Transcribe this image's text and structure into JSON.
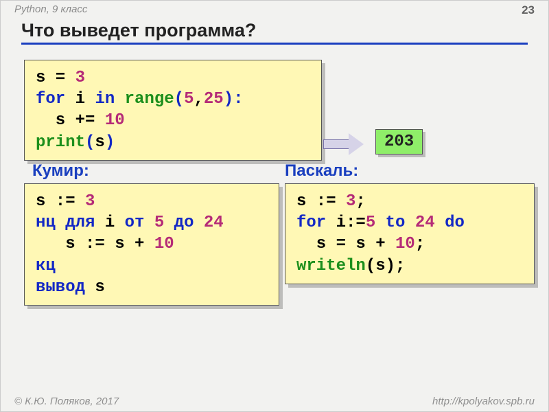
{
  "header": {
    "course": "Python, 9 класс",
    "page": "23"
  },
  "title": "Что выведет программа?",
  "python": {
    "l1_pre": "s = ",
    "l1_val": "3",
    "l2_for": "for",
    "l2_i": " i ",
    "l2_in": "in",
    "l2_sp": " ",
    "l2_range": "range",
    "l2_open": "(",
    "l2_a": "5",
    "l2_comma": ",",
    "l2_b": "25",
    "l2_close": "):",
    "l3_pre": "  s += ",
    "l3_val": "10",
    "l4_fn": "print",
    "l4_open": "(",
    "l4_arg": "s",
    "l4_close": ")"
  },
  "answer": "203",
  "labels": {
    "kumir": "Кумир:",
    "pascal": "Паскаль:"
  },
  "kumir": {
    "l1_pre": "s := ",
    "l1_val": "3",
    "l2_nc": "нц для",
    "l2_i": " i ",
    "l2_from": "от",
    "l2_sp1": " ",
    "l2_a": "5",
    "l2_sp2": " ",
    "l2_to": "до",
    "l2_sp3": " ",
    "l2_b": "24",
    "l3_pre": "   s := s + ",
    "l3_val": "10",
    "l4": "кц",
    "l5_kw": "вывод",
    "l5_arg": " s"
  },
  "pascal": {
    "l1_pre": "s := ",
    "l1_val": "3",
    "l1_term": ";",
    "l2_for": "for",
    "l2_sp1": " ",
    "l2_i": "i:=",
    "l2_a": "5",
    "l2_sp2": " ",
    "l2_to": "to",
    "l2_sp3": " ",
    "l2_b": "24",
    "l2_sp4": " ",
    "l2_do": "do",
    "l3_pre": "  s = s + ",
    "l3_val": "10",
    "l3_term": ";",
    "l4_fn": "writeln",
    "l4_open": "(",
    "l4_arg": "s",
    "l4_close": ");"
  },
  "footer": {
    "copyright": "© К.Ю. Поляков, 2017",
    "url": "http://kpolyakov.spb.ru"
  }
}
